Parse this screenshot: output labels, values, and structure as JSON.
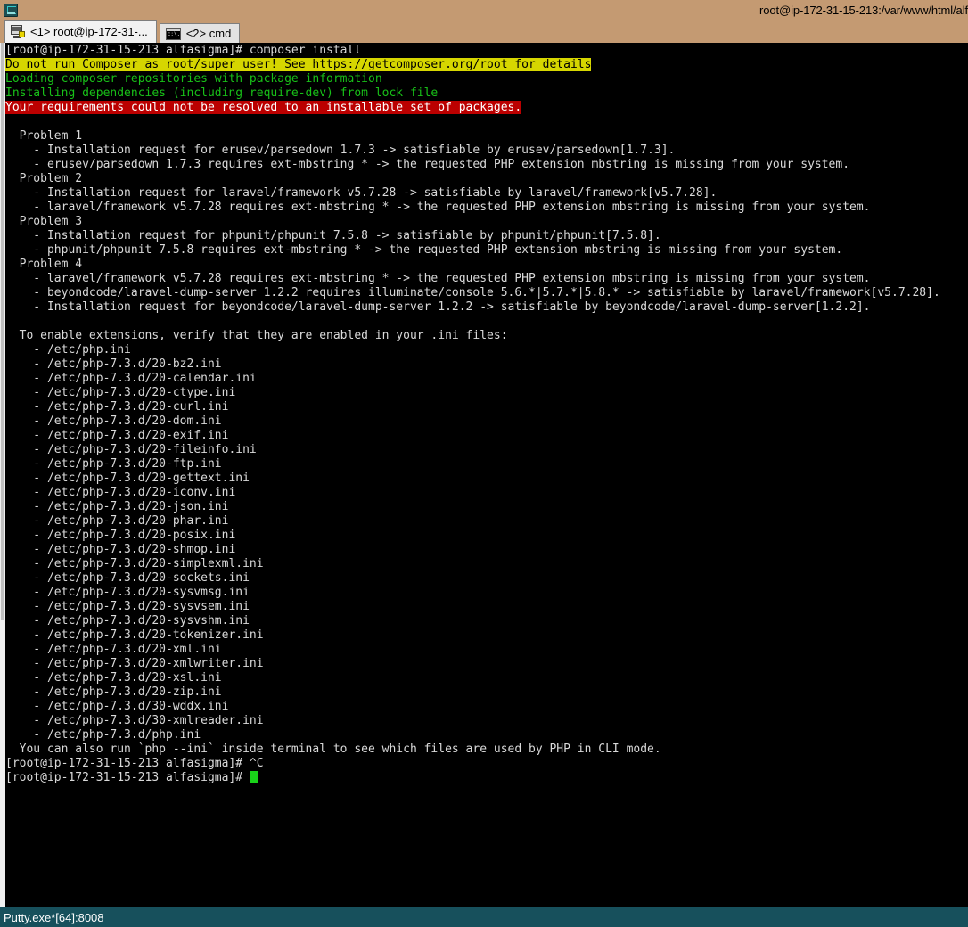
{
  "window": {
    "title": "root@ip-172-31-15-213:/var/www/html/alf",
    "icon": "monitor-icon"
  },
  "tabs": [
    {
      "label": "<1> root@ip-172-31-...",
      "icon": "putty-icon",
      "active": true
    },
    {
      "label": "<2> cmd",
      "icon": "cmd-console-icon",
      "active": false
    }
  ],
  "statusbar": {
    "text": "Putty.exe*[64]:8008"
  },
  "colors": {
    "titlebar_bg": "#c49a72",
    "terminal_bg": "#000000",
    "text_default": "#d9d9d9",
    "text_green": "#18c018",
    "warn_bg": "#d6d600",
    "warn_fg": "#000000",
    "error_bg": "#bb0000",
    "error_fg": "#ffffff",
    "cursor": "#19d219",
    "statusbar_bg": "#17505c"
  },
  "terminal": {
    "prompt": "[root@ip-172-31-15-213 alfasigma]# ",
    "lines": [
      {
        "text": "[root@ip-172-31-15-213 alfasigma]# composer install",
        "style": "white"
      },
      {
        "text": "Do not run Composer as root/super user! See https://getcomposer.org/root for details",
        "style": "hl-yellow"
      },
      {
        "text": "Loading composer repositories with package information",
        "style": "green"
      },
      {
        "text": "Installing dependencies (including require-dev) from lock file",
        "style": "green"
      },
      {
        "text": "Your requirements could not be resolved to an installable set of packages.",
        "style": "hl-red"
      },
      {
        "text": "",
        "style": "white"
      },
      {
        "text": "  Problem 1",
        "style": "white"
      },
      {
        "text": "    - Installation request for erusev/parsedown 1.7.3 -> satisfiable by erusev/parsedown[1.7.3].",
        "style": "white"
      },
      {
        "text": "    - erusev/parsedown 1.7.3 requires ext-mbstring * -> the requested PHP extension mbstring is missing from your system.",
        "style": "white"
      },
      {
        "text": "  Problem 2",
        "style": "white"
      },
      {
        "text": "    - Installation request for laravel/framework v5.7.28 -> satisfiable by laravel/framework[v5.7.28].",
        "style": "white"
      },
      {
        "text": "    - laravel/framework v5.7.28 requires ext-mbstring * -> the requested PHP extension mbstring is missing from your system.",
        "style": "white"
      },
      {
        "text": "  Problem 3",
        "style": "white"
      },
      {
        "text": "    - Installation request for phpunit/phpunit 7.5.8 -> satisfiable by phpunit/phpunit[7.5.8].",
        "style": "white"
      },
      {
        "text": "    - phpunit/phpunit 7.5.8 requires ext-mbstring * -> the requested PHP extension mbstring is missing from your system.",
        "style": "white"
      },
      {
        "text": "  Problem 4",
        "style": "white"
      },
      {
        "text": "    - laravel/framework v5.7.28 requires ext-mbstring * -> the requested PHP extension mbstring is missing from your system.",
        "style": "white"
      },
      {
        "text": "    - beyondcode/laravel-dump-server 1.2.2 requires illuminate/console 5.6.*|5.7.*|5.8.* -> satisfiable by laravel/framework[v5.7.28].",
        "style": "white"
      },
      {
        "text": "    - Installation request for beyondcode/laravel-dump-server 1.2.2 -> satisfiable by beyondcode/laravel-dump-server[1.2.2].",
        "style": "white"
      },
      {
        "text": "",
        "style": "white"
      },
      {
        "text": "  To enable extensions, verify that they are enabled in your .ini files:",
        "style": "white"
      },
      {
        "text": "    - /etc/php.ini",
        "style": "white"
      },
      {
        "text": "    - /etc/php-7.3.d/20-bz2.ini",
        "style": "white"
      },
      {
        "text": "    - /etc/php-7.3.d/20-calendar.ini",
        "style": "white"
      },
      {
        "text": "    - /etc/php-7.3.d/20-ctype.ini",
        "style": "white"
      },
      {
        "text": "    - /etc/php-7.3.d/20-curl.ini",
        "style": "white"
      },
      {
        "text": "    - /etc/php-7.3.d/20-dom.ini",
        "style": "white"
      },
      {
        "text": "    - /etc/php-7.3.d/20-exif.ini",
        "style": "white"
      },
      {
        "text": "    - /etc/php-7.3.d/20-fileinfo.ini",
        "style": "white"
      },
      {
        "text": "    - /etc/php-7.3.d/20-ftp.ini",
        "style": "white"
      },
      {
        "text": "    - /etc/php-7.3.d/20-gettext.ini",
        "style": "white"
      },
      {
        "text": "    - /etc/php-7.3.d/20-iconv.ini",
        "style": "white"
      },
      {
        "text": "    - /etc/php-7.3.d/20-json.ini",
        "style": "white"
      },
      {
        "text": "    - /etc/php-7.3.d/20-phar.ini",
        "style": "white"
      },
      {
        "text": "    - /etc/php-7.3.d/20-posix.ini",
        "style": "white"
      },
      {
        "text": "    - /etc/php-7.3.d/20-shmop.ini",
        "style": "white"
      },
      {
        "text": "    - /etc/php-7.3.d/20-simplexml.ini",
        "style": "white"
      },
      {
        "text": "    - /etc/php-7.3.d/20-sockets.ini",
        "style": "white"
      },
      {
        "text": "    - /etc/php-7.3.d/20-sysvmsg.ini",
        "style": "white"
      },
      {
        "text": "    - /etc/php-7.3.d/20-sysvsem.ini",
        "style": "white"
      },
      {
        "text": "    - /etc/php-7.3.d/20-sysvshm.ini",
        "style": "white"
      },
      {
        "text": "    - /etc/php-7.3.d/20-tokenizer.ini",
        "style": "white"
      },
      {
        "text": "    - /etc/php-7.3.d/20-xml.ini",
        "style": "white"
      },
      {
        "text": "    - /etc/php-7.3.d/20-xmlwriter.ini",
        "style": "white"
      },
      {
        "text": "    - /etc/php-7.3.d/20-xsl.ini",
        "style": "white"
      },
      {
        "text": "    - /etc/php-7.3.d/20-zip.ini",
        "style": "white"
      },
      {
        "text": "    - /etc/php-7.3.d/30-wddx.ini",
        "style": "white"
      },
      {
        "text": "    - /etc/php-7.3.d/30-xmlreader.ini",
        "style": "white"
      },
      {
        "text": "    - /etc/php-7.3.d/php.ini",
        "style": "white"
      },
      {
        "text": "  You can also run `php --ini` inside terminal to see which files are used by PHP in CLI mode.",
        "style": "white"
      },
      {
        "text": "[root@ip-172-31-15-213 alfasigma]# ^C",
        "style": "white"
      },
      {
        "text": "[root@ip-172-31-15-213 alfasigma]# ",
        "style": "white",
        "cursor": true
      }
    ]
  }
}
